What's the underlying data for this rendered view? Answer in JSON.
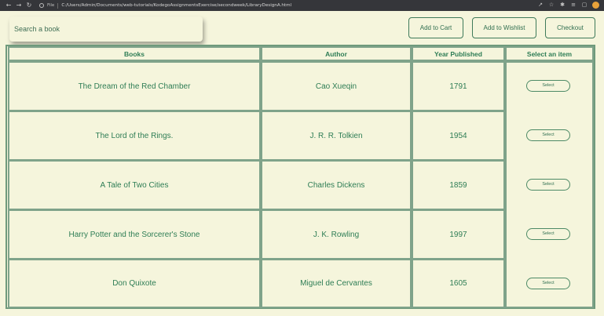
{
  "browser": {
    "back_icon": "arrow-left-icon",
    "forward_icon": "arrow-right-icon",
    "reload_icon": "reload-icon",
    "file_tag": "File",
    "url": "C:/Users/Admin/Documents/web-tutorials/KodegoAssignmentsExercise/secondweek/LibraryDesignA.html"
  },
  "search": {
    "placeholder": "Search a book"
  },
  "actions": {
    "add_to_cart": "Add to Cart",
    "add_to_wishlist": "Add to Wishlist",
    "checkout": "Checkout"
  },
  "table": {
    "headers": {
      "books": "Books",
      "author": "Author",
      "year": "Year Published",
      "select": "Select an item"
    },
    "rows": [
      {
        "book": "The Dream of the Red Chamber",
        "author": "Cao Xueqin",
        "year": "1791",
        "button": "Select"
      },
      {
        "book": "The Lord of the Rings.",
        "author": "J. R. R. Tolkien",
        "year": "1954",
        "button": "Select"
      },
      {
        "book": "A Tale of Two Cities",
        "author": "Charles Dickens",
        "year": "1859",
        "button": "Select"
      },
      {
        "book": "Harry Potter and the Sorcerer's Stone",
        "author": "J. K. Rowling",
        "year": "1997",
        "button": "Select"
      },
      {
        "book": "Don Quixote",
        "author": "Miguel de Cervantes",
        "year": "1605",
        "button": "Select"
      }
    ]
  },
  "colors": {
    "page_bg": "#f5f5dc",
    "text_green": "#2e7d55",
    "border_green": "#7fa38a"
  }
}
